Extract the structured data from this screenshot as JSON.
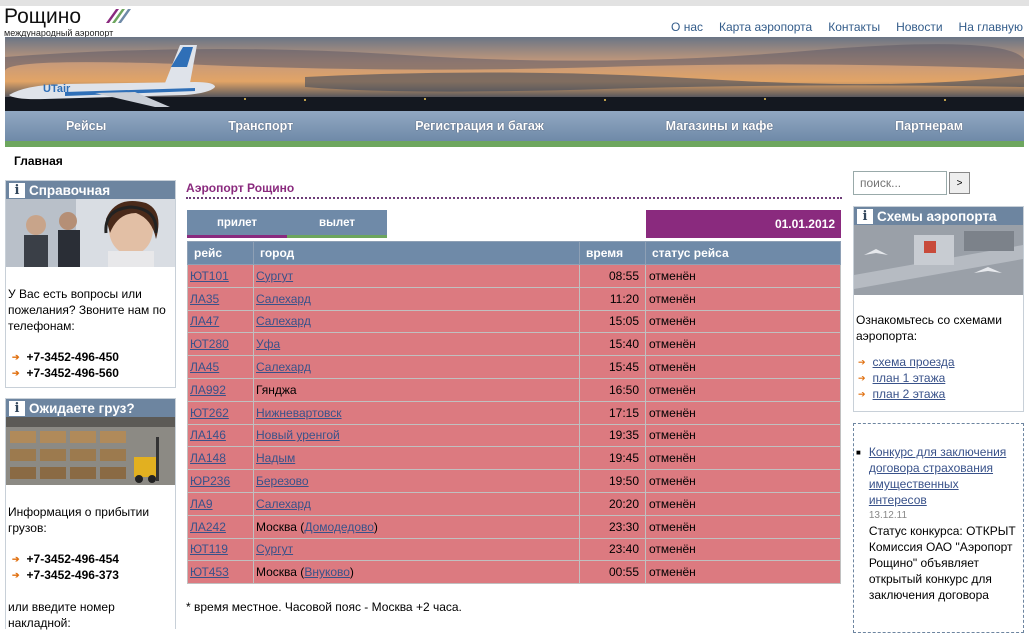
{
  "header": {
    "logo_name": "Рощино",
    "logo_sub": "международный аэропорт",
    "top_links": [
      "О нас",
      "Карта аэропорта",
      "Контакты",
      "Новости",
      "На главную"
    ]
  },
  "banner": {
    "tail_text": "UTair"
  },
  "nav": [
    "Рейсы",
    "Транспорт",
    "Регистрация и багаж",
    "Магазины и кафе",
    "Партнерам"
  ],
  "breadcrumb": "Главная",
  "left": {
    "help": {
      "title": "Справочная",
      "text": "У Вас есть вопросы или пожелания? Звоните нам по телефонам:",
      "phones": [
        "+7-3452-496-450",
        "+7-3452-496-560"
      ]
    },
    "cargo": {
      "title": "Ожидаете груз?",
      "text": "Информация о прибытии грузов:",
      "phones": [
        "+7-3452-496-454",
        "+7-3452-496-373"
      ],
      "text2": "или введите номер накладной:"
    }
  },
  "main": {
    "title": "Аэропорт Рощино",
    "tabs": [
      "прилет",
      "вылет"
    ],
    "date": "01.01.2012",
    "columns": [
      "рейс",
      "город",
      "время",
      "статус рейса"
    ],
    "rows": [
      {
        "flight": "ЮТ101",
        "city": "Сургут",
        "city_link": true,
        "time": "08:55",
        "status": "отменён"
      },
      {
        "flight": "ЛА35",
        "city": "Салехард",
        "city_link": true,
        "time": "11:20",
        "status": "отменён"
      },
      {
        "flight": "ЛА47",
        "city": "Салехард",
        "city_link": true,
        "time": "15:05",
        "status": "отменён"
      },
      {
        "flight": "ЮТ280",
        "city": "Уфа",
        "city_link": true,
        "time": "15:40",
        "status": "отменён"
      },
      {
        "flight": "ЛА45",
        "city": "Салехард",
        "city_link": true,
        "time": "15:45",
        "status": "отменён"
      },
      {
        "flight": "ЛА992",
        "city": "Гянджа",
        "city_link": false,
        "time": "16:50",
        "status": "отменён"
      },
      {
        "flight": "ЮТ262",
        "city": "Нижневартовск",
        "city_link": true,
        "time": "17:15",
        "status": "отменён"
      },
      {
        "flight": "ЛА146",
        "city": "Новый уренгой",
        "city_link": true,
        "time": "19:35",
        "status": "отменён"
      },
      {
        "flight": "ЛА148",
        "city": "Надым",
        "city_link": true,
        "time": "19:45",
        "status": "отменён"
      },
      {
        "flight": "ЮР236",
        "city": "Березово",
        "city_link": true,
        "time": "19:50",
        "status": "отменён"
      },
      {
        "flight": "ЛА9",
        "city": "Салехард",
        "city_link": true,
        "time": "20:20",
        "status": "отменён"
      },
      {
        "flight": "ЛА242",
        "city": "Москва",
        "city_link": false,
        "airport": "Домодедово",
        "time": "23:30",
        "status": "отменён"
      },
      {
        "flight": "ЮТ119",
        "city": "Сургут",
        "city_link": true,
        "time": "23:40",
        "status": "отменён"
      },
      {
        "flight": "ЮТ453",
        "city": "Москва",
        "city_link": false,
        "airport": "Внуково",
        "time": "00:55",
        "status": "отменён"
      }
    ],
    "note": "* время местное. Часовой пояс - Москва +2 часа."
  },
  "right": {
    "search": {
      "placeholder": "поиск...",
      "button": ">"
    },
    "schemes": {
      "title": "Схемы аэропорта",
      "text": "Ознакомьтесь со схемами аэропорта:",
      "links": [
        "схема проезда",
        "план 1 этажа",
        "план 2 этажа"
      ]
    },
    "news": {
      "title_link": "Конкурс для заключения договора страхования имущественных интересов",
      "date": "13.12.11",
      "text": "Статус конкурса: ОТКРЫТ Комиссия ОАО \"Аэропорт Рощино\" объявляет открытый конкурс для заключения договора"
    }
  },
  "colors": {
    "accent_nav": "#6f8aa8",
    "row_bg": "#dc7a80",
    "date_bg": "#8a2a7e",
    "green_line": "#6da65e"
  }
}
